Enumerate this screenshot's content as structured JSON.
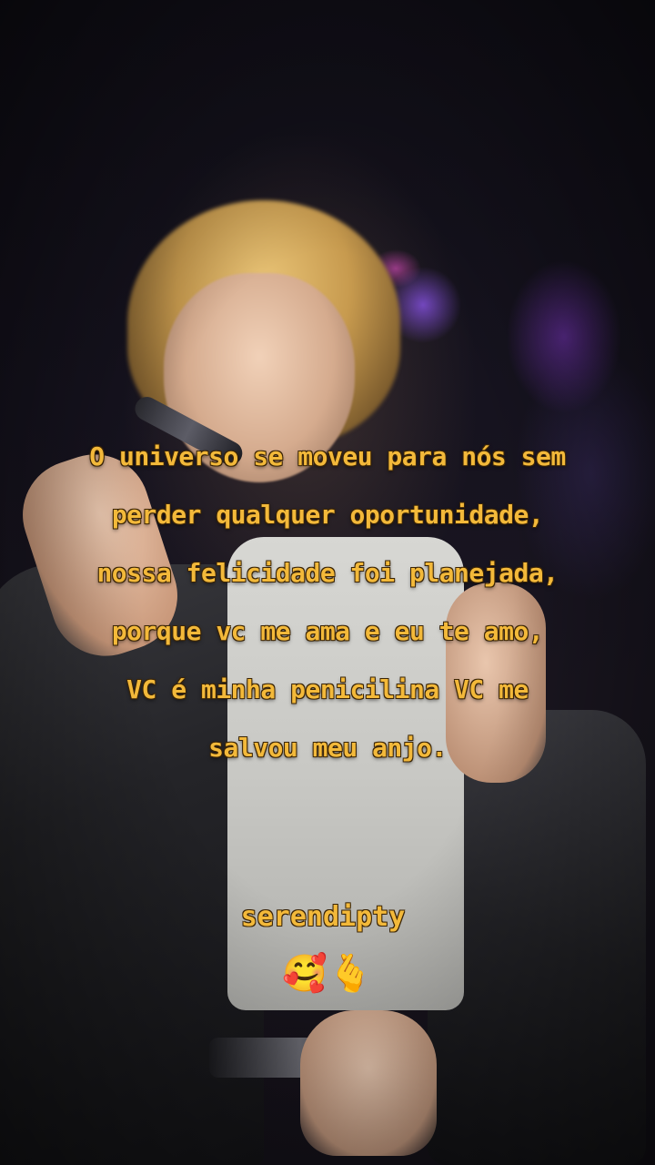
{
  "caption": {
    "lines": [
      "O universo se moveu para nós sem",
      "perder qualquer oportunidade,",
      "nossa felicidade foi planejada,",
      "porque vc me ama e eu te amo,",
      "VC é minha penicilina VC me",
      "salvou meu anjo."
    ]
  },
  "signature": "serendipty",
  "emojis": "🥰🫰",
  "colors": {
    "caption_text": "#f3b93a",
    "caption_outline": "#3a2406"
  }
}
